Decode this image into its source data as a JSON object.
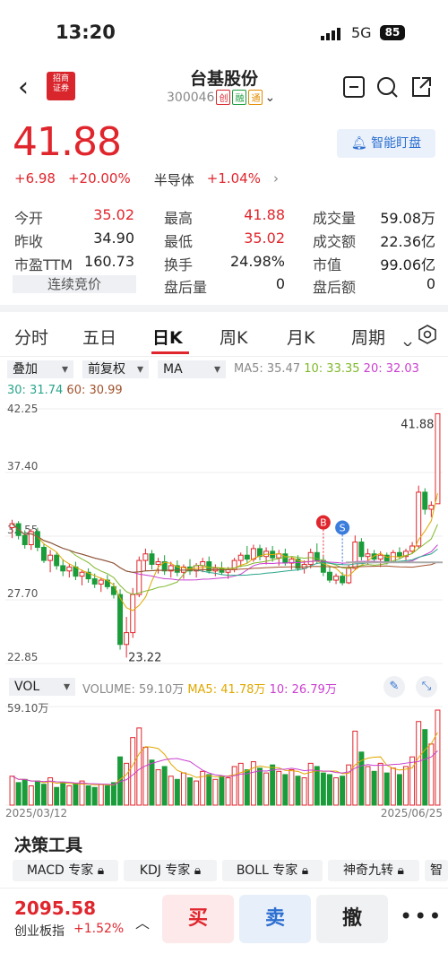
{
  "status": {
    "time": "13:20",
    "network": "5G",
    "battery": "85"
  },
  "header": {
    "name": "台基股份",
    "code": "300046",
    "tags": [
      "创",
      "融",
      "通"
    ],
    "logo_text": "招商证券"
  },
  "quote": {
    "price": "41.88",
    "change": "+6.98",
    "change_pct": "+20.00%",
    "sector": "半导体",
    "sector_pct": "+1.04%",
    "alert_label": "智能盯盘"
  },
  "stats": [
    {
      "label": "今开",
      "value": "35.02",
      "color": "red"
    },
    {
      "label": "最高",
      "value": "41.88",
      "color": "red"
    },
    {
      "label": "成交量",
      "value": "59.08万",
      "color": "black"
    },
    {
      "label": "昨收",
      "value": "34.90",
      "color": "black"
    },
    {
      "label": "最低",
      "value": "35.02",
      "color": "red"
    },
    {
      "label": "成交额",
      "value": "22.36亿",
      "color": "black"
    },
    {
      "label": "市盈TTM",
      "value": "160.73",
      "color": "black"
    },
    {
      "label": "换手",
      "value": "24.98%",
      "color": "black"
    },
    {
      "label": "市值",
      "value": "99.06亿",
      "color": "black"
    },
    {
      "label": "连续竞价",
      "value": "",
      "color": "black"
    },
    {
      "label": "盘后量",
      "value": "0",
      "color": "black"
    },
    {
      "label": "盘后额",
      "value": "0",
      "color": "black"
    }
  ],
  "tabs": [
    "分时",
    "五日",
    "日K",
    "周K",
    "月K",
    "周期"
  ],
  "controls": {
    "overlay": "叠加",
    "adjust": "前复权",
    "indicator": "MA",
    "vol": "VOL"
  },
  "ma_labels": {
    "ma5": "MA5: 35.47",
    "ma10": "10: 33.35",
    "ma20": "20: 32.03",
    "ma30": "30: 31.74",
    "ma60": "60: 30.99"
  },
  "vol_labels": {
    "volume": "VOLUME: 59.10万",
    "ma5": "MA5: 41.78万",
    "ma10": "10: 26.79万",
    "max": "59.10万"
  },
  "colors": {
    "up": "#e0262d",
    "down": "#1a9c3a",
    "ma5": "#e0a800",
    "ma10": "#7fb82a",
    "ma20": "#c93fd0",
    "ma30": "#2aa58b",
    "ma60": "#a0522d"
  },
  "chart_data": {
    "type": "candlestick",
    "y_ticks": [
      "42.25",
      "37.40",
      "32.55",
      "27.70",
      "22.85"
    ],
    "ylim": [
      22.85,
      42.25
    ],
    "x_labels": [
      "2025/03/12",
      "2025/06/25"
    ],
    "annotations": {
      "high": "41.88",
      "low": "23.22",
      "buy_marker": "B",
      "sell_marker": "S"
    },
    "candles": [
      [
        33.2,
        33.8,
        32.4,
        33.5
      ],
      [
        33.5,
        33.7,
        32.3,
        32.6
      ],
      [
        32.6,
        33.0,
        31.6,
        31.9
      ],
      [
        31.9,
        33.1,
        31.5,
        32.9
      ],
      [
        32.9,
        33.2,
        31.4,
        31.7
      ],
      [
        31.7,
        32.0,
        30.5,
        30.7
      ],
      [
        30.7,
        31.5,
        29.8,
        31.1
      ],
      [
        31.1,
        31.3,
        30.0,
        30.3
      ],
      [
        30.3,
        30.8,
        29.5,
        29.9
      ],
      [
        29.9,
        30.4,
        29.4,
        30.2
      ],
      [
        30.2,
        30.6,
        29.2,
        29.5
      ],
      [
        29.5,
        30.0,
        28.8,
        29.8
      ],
      [
        29.8,
        30.1,
        29.0,
        29.3
      ],
      [
        29.3,
        29.7,
        28.6,
        28.9
      ],
      [
        28.9,
        29.4,
        28.3,
        29.2
      ],
      [
        29.2,
        29.6,
        28.5,
        28.7
      ],
      [
        28.7,
        29.0,
        27.8,
        28.1
      ],
      [
        28.1,
        28.5,
        23.9,
        24.3
      ],
      [
        24.3,
        26.4,
        23.3,
        25.2
      ],
      [
        25.2,
        28.6,
        24.8,
        28.1
      ],
      [
        28.1,
        31.0,
        27.9,
        30.7
      ],
      [
        30.7,
        31.6,
        29.9,
        31.2
      ],
      [
        31.2,
        31.5,
        30.0,
        30.4
      ],
      [
        30.4,
        30.9,
        29.7,
        30.6
      ],
      [
        30.6,
        31.1,
        29.6,
        29.9
      ],
      [
        29.9,
        30.6,
        29.4,
        30.3
      ],
      [
        30.3,
        30.7,
        29.5,
        29.8
      ],
      [
        29.8,
        30.4,
        29.3,
        30.2
      ],
      [
        30.2,
        30.8,
        29.6,
        29.9
      ],
      [
        29.9,
        30.5,
        29.4,
        30.3
      ],
      [
        30.3,
        30.9,
        29.8,
        30.6
      ],
      [
        30.6,
        31.0,
        29.7,
        29.9
      ],
      [
        29.9,
        30.4,
        29.5,
        30.1
      ],
      [
        30.1,
        30.6,
        29.6,
        29.8
      ],
      [
        29.8,
        30.2,
        29.3,
        30.0
      ],
      [
        30.0,
        30.9,
        29.8,
        30.7
      ],
      [
        30.7,
        31.3,
        30.2,
        31.1
      ],
      [
        31.1,
        31.8,
        30.5,
        30.8
      ],
      [
        30.8,
        31.9,
        30.6,
        31.6
      ],
      [
        31.6,
        31.9,
        30.7,
        31.0
      ],
      [
        31.0,
        31.7,
        30.4,
        31.4
      ],
      [
        31.4,
        31.8,
        30.6,
        30.9
      ],
      [
        30.9,
        31.5,
        30.3,
        31.2
      ],
      [
        31.2,
        31.6,
        30.3,
        30.5
      ],
      [
        30.5,
        31.0,
        30.0,
        30.8
      ],
      [
        30.8,
        31.1,
        29.9,
        30.1
      ],
      [
        30.1,
        30.7,
        29.7,
        30.4
      ],
      [
        30.4,
        31.6,
        30.1,
        31.3
      ],
      [
        31.3,
        32.0,
        30.5,
        30.7
      ],
      [
        30.7,
        31.0,
        29.5,
        29.8
      ],
      [
        29.8,
        30.2,
        29.0,
        29.2
      ],
      [
        29.2,
        29.7,
        28.9,
        29.5
      ],
      [
        29.5,
        29.8,
        28.8,
        29.0
      ],
      [
        29.0,
        30.4,
        28.9,
        30.1
      ],
      [
        30.1,
        32.6,
        30.0,
        32.1
      ],
      [
        32.1,
        32.4,
        30.7,
        31.0
      ],
      [
        31.0,
        31.6,
        30.4,
        31.2
      ],
      [
        31.2,
        31.5,
        30.5,
        30.8
      ],
      [
        30.8,
        31.4,
        30.2,
        31.1
      ],
      [
        31.1,
        31.3,
        30.4,
        30.6
      ],
      [
        30.6,
        31.5,
        30.5,
        31.3
      ],
      [
        31.3,
        31.7,
        30.8,
        31.0
      ],
      [
        31.0,
        31.6,
        30.7,
        31.4
      ],
      [
        31.4,
        32.1,
        31.2,
        31.8
      ],
      [
        31.8,
        36.4,
        31.6,
        35.9
      ],
      [
        35.9,
        36.2,
        34.2,
        34.6
      ],
      [
        34.6,
        35.2,
        34.0,
        34.9
      ],
      [
        35.02,
        41.88,
        35.02,
        41.88
      ]
    ],
    "volumes": [
      18,
      14,
      16,
      12,
      15,
      13,
      17,
      11,
      14,
      12,
      13,
      15,
      12,
      11,
      13,
      12,
      14,
      30,
      26,
      42,
      48,
      36,
      28,
      22,
      24,
      18,
      16,
      20,
      17,
      15,
      21,
      19,
      16,
      18,
      17,
      24,
      26,
      22,
      27,
      23,
      20,
      25,
      21,
      19,
      22,
      18,
      17,
      26,
      24,
      20,
      19,
      17,
      18,
      25,
      46,
      33,
      24,
      21,
      26,
      20,
      23,
      19,
      24,
      30,
      52,
      47,
      38,
      59.1
    ]
  },
  "tools": {
    "title": "决策工具",
    "items": [
      "MACD 专家",
      "KDJ 专家",
      "BOLL 专家",
      "神奇九转",
      "智"
    ]
  },
  "bottom": {
    "index_value": "2095.58",
    "index_name": "创业板指",
    "index_change": "+1.52%",
    "buy": "买",
    "sell": "卖",
    "cancel": "撤",
    "more": "•••"
  }
}
